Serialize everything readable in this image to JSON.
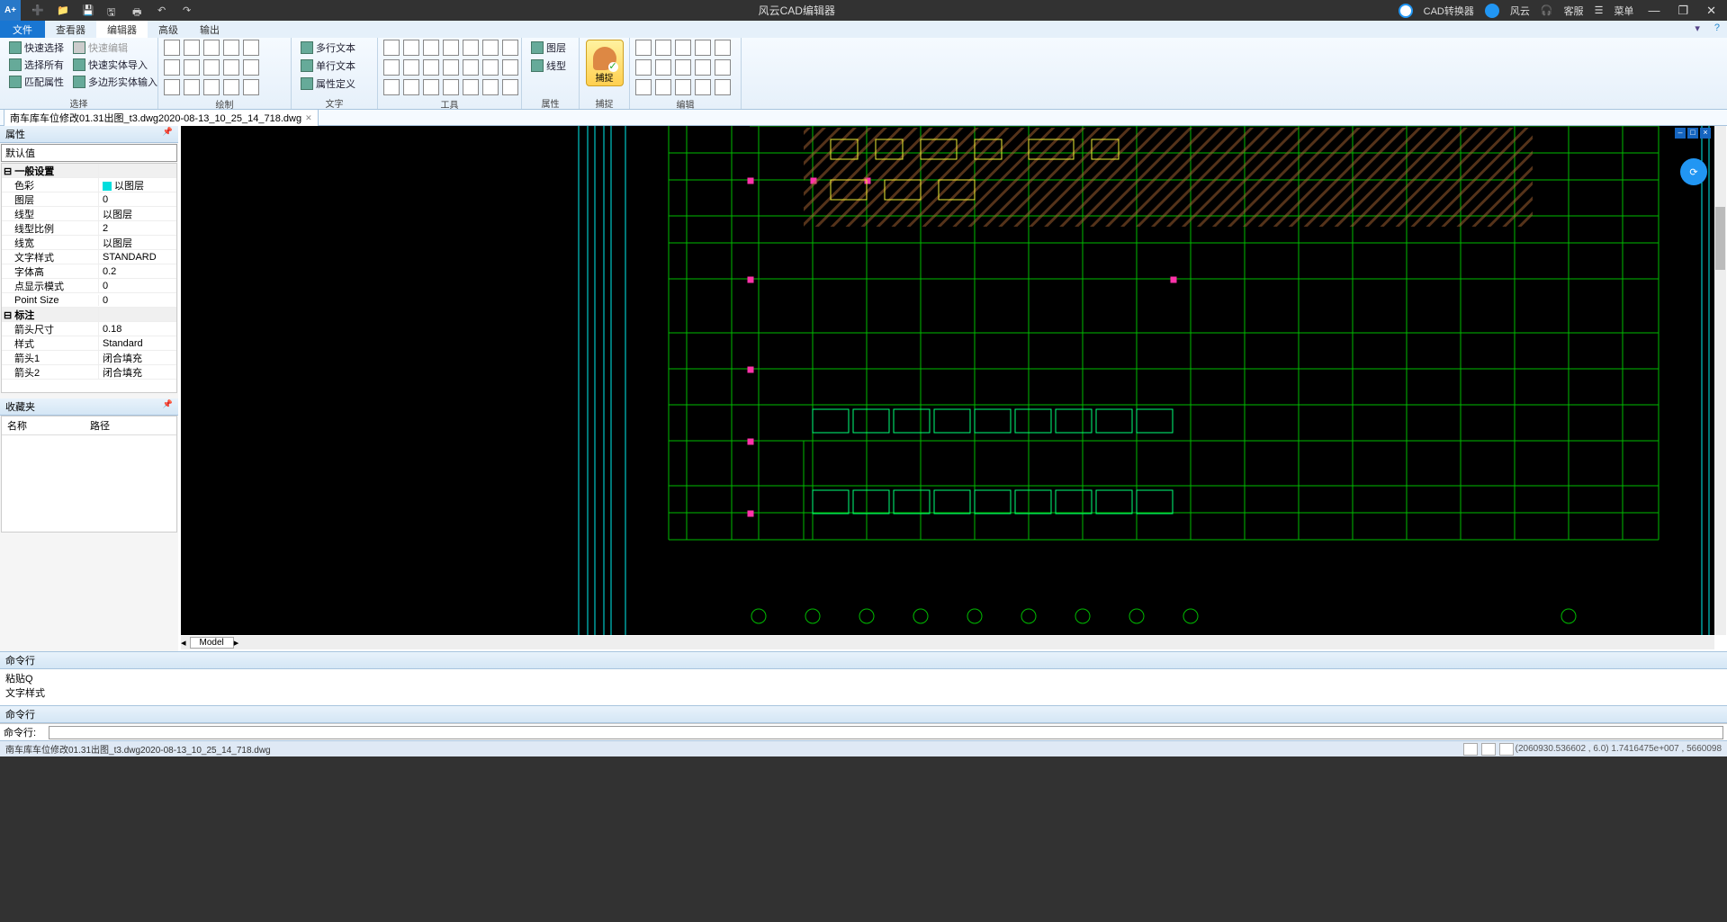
{
  "title": "风云CAD编辑器",
  "titlebar_right": {
    "convert": "CAD转换器",
    "brand": "风云",
    "service": "客服",
    "menu": "菜单"
  },
  "menus": {
    "file": "文件",
    "view": "查看器",
    "edit": "编辑器",
    "adv": "高级",
    "output": "输出"
  },
  "ribbon": {
    "select": {
      "quick": "快速选择",
      "all": "选择所有",
      "match": "匹配属性",
      "quickedit": "快速编辑",
      "import": "快速实体导入",
      "poly": "多边形实体输入",
      "group": "选择"
    },
    "draw": {
      "group": "绘制"
    },
    "text": {
      "multi": "多行文本",
      "single": "单行文本",
      "attr": "属性定义",
      "group": "文字"
    },
    "tools": {
      "group": "工具"
    },
    "layer": {
      "layer": "图层",
      "linetype": "线型",
      "group": "属性"
    },
    "snap": {
      "btn": "捕捉",
      "group": "捕捉"
    },
    "edit": {
      "group": "编辑"
    }
  },
  "file_tab": "南车库车位修改01.31出图_t3.dwg2020-08-13_10_25_14_718.dwg",
  "prop_panel": {
    "title": "属性",
    "default": "默认值",
    "group_general": "一般设置",
    "rows": [
      {
        "k": "色彩",
        "v": "以图层",
        "swatch": true
      },
      {
        "k": "图层",
        "v": "0"
      },
      {
        "k": "线型",
        "v": "以图层"
      },
      {
        "k": "线型比例",
        "v": "2"
      },
      {
        "k": "线宽",
        "v": "以图层"
      },
      {
        "k": "文字样式",
        "v": "STANDARD"
      },
      {
        "k": "字体高",
        "v": "0.2"
      },
      {
        "k": "点显示模式",
        "v": "0"
      },
      {
        "k": "Point Size",
        "v": "0"
      }
    ],
    "group_dim": "标注",
    "dim_rows": [
      {
        "k": "箭头尺寸",
        "v": "0.18"
      },
      {
        "k": "样式",
        "v": "Standard"
      },
      {
        "k": "箭头1",
        "v": "闭合填充"
      },
      {
        "k": "箭头2",
        "v": "闭合填充"
      }
    ]
  },
  "fav_panel": {
    "title": "收藏夹",
    "col1": "名称",
    "col2": "路径"
  },
  "model_tab": "Model",
  "cmd": {
    "title": "命令行",
    "hist1": "粘贴Q",
    "hist2": "文字样式",
    "prompt": "命令行:"
  },
  "status": {
    "file": "南车库车位修改01.31出图_t3.dwg2020-08-13_10_25_14_718.dwg",
    "coords": "(2060930.536602 , 6.0)      1.7416475e+007 , 5660098"
  }
}
